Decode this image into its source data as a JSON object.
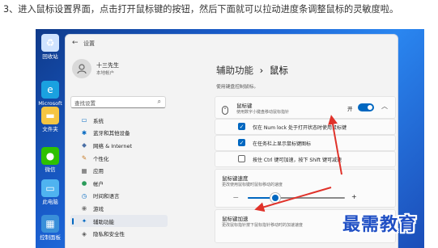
{
  "instruction": "3、进入鼠标设置界面，点击打开鼠标键的按钮，然后下面就可以拉动进度条调整鼠标的灵敏度啦。",
  "desktop": {
    "icons": [
      {
        "label": "回收站",
        "icon": "recycle-bin-icon",
        "glyph": "♻",
        "color": "#cfe3ff"
      },
      {
        "label": "Microsoft Edge",
        "icon": "edge-icon",
        "glyph": "e",
        "color": "#1aa1e0"
      },
      {
        "label": "文件夹",
        "icon": "folder-icon",
        "glyph": "▬",
        "color": "#f5c542"
      },
      {
        "label": "微信",
        "icon": "wechat-icon",
        "glyph": "●",
        "color": "#2dc100"
      },
      {
        "label": "此电脑",
        "icon": "computer-icon",
        "glyph": "▭",
        "color": "#4fb3f0"
      },
      {
        "label": "控制面板",
        "icon": "control-panel-icon",
        "glyph": "▦",
        "color": "#3a8fd9"
      }
    ]
  },
  "window": {
    "title": "设置",
    "back_icon": "back-arrow-icon"
  },
  "user": {
    "name": "十三先生",
    "account": "本地帐户",
    "avatar_icon": "user-avatar-icon"
  },
  "search": {
    "placeholder": "查找设置"
  },
  "nav": [
    {
      "label": "系统",
      "icon": "system-icon",
      "glyph": "▭",
      "color": "#0067c0"
    },
    {
      "label": "蓝牙和其他设备",
      "icon": "bluetooth-icon",
      "glyph": "✱",
      "color": "#0067c0"
    },
    {
      "label": "网络 & Internet",
      "icon": "network-icon",
      "glyph": "◆",
      "color": "#4a6fa5"
    },
    {
      "label": "个性化",
      "icon": "brush-icon",
      "glyph": "✎",
      "color": "#c77d2a"
    },
    {
      "label": "应用",
      "icon": "apps-icon",
      "glyph": "▦",
      "color": "#555555"
    },
    {
      "label": "帐户",
      "icon": "account-icon",
      "glyph": "●",
      "color": "#2b9b5a"
    },
    {
      "label": "时间和语言",
      "icon": "time-language-icon",
      "glyph": "◷",
      "color": "#0067c0"
    },
    {
      "label": "游戏",
      "icon": "gaming-icon",
      "glyph": "◉",
      "color": "#777777"
    },
    {
      "label": "辅助功能",
      "icon": "accessibility-icon",
      "glyph": "✦",
      "color": "#0067c0",
      "active": true
    },
    {
      "label": "隐私和安全性",
      "icon": "privacy-icon",
      "glyph": "◈",
      "color": "#555555"
    }
  ],
  "main": {
    "breadcrumb_parent": "辅助功能",
    "breadcrumb_sep": "›",
    "breadcrumb_current": "鼠标",
    "description": "使用键盘控制鼠标。",
    "mouse_keys": {
      "title": "鼠标键",
      "subtitle": "使用数字小键盘移动鼠标指针",
      "toggle_label": "开",
      "toggle_on": true,
      "icon": "mouse-icon",
      "chevron_icon": "chevron-up-icon"
    },
    "options": [
      {
        "label": "仅在 Num lock 处于打开状态时使用鼠标键",
        "checked": true
      },
      {
        "label": "在任务栏上显示鼠标键图标",
        "checked": true
      },
      {
        "label": "按住 Ctrl 键可加速，按下 Shift 键可减速",
        "checked": false
      }
    ],
    "speed": {
      "title": "鼠标键速度",
      "subtitle": "更改使用鼠标键时鼠标移动的速度",
      "minus": "—",
      "plus": "+",
      "value_fraction": 0.28
    },
    "accel": {
      "title": "鼠标键加速",
      "subtitle": "更改鼠标指针按下鼠标指针移动时的加速速度"
    }
  },
  "arrows_color": "#e0322a",
  "watermark": "最需教育"
}
